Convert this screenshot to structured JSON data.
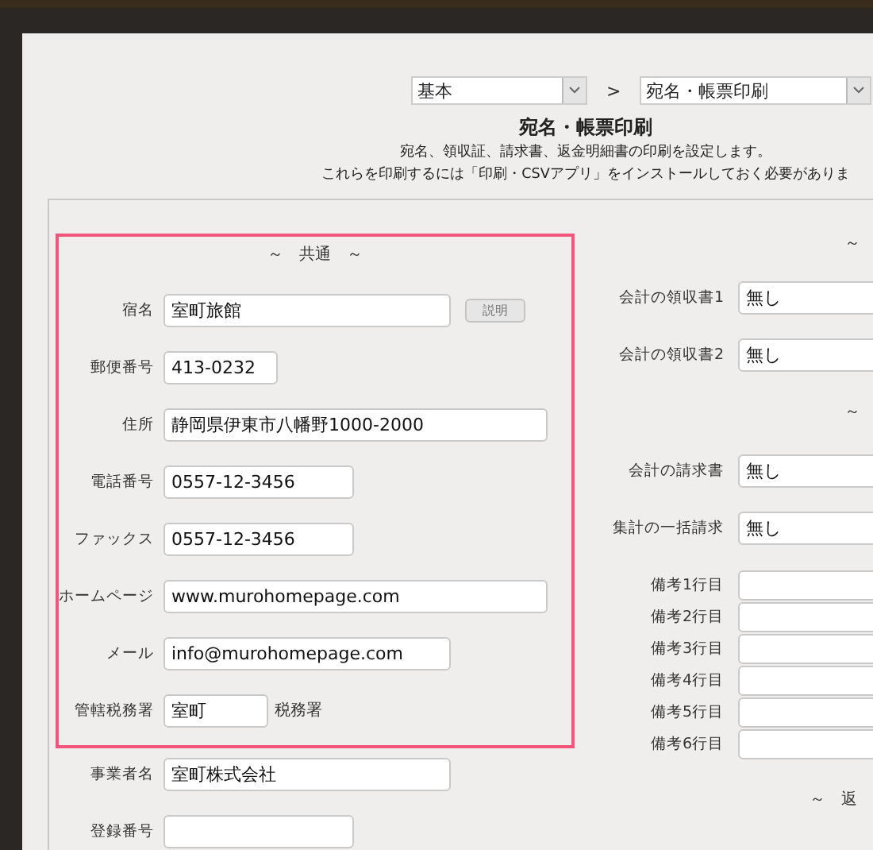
{
  "breadcrumb": {
    "levels": [
      {
        "value": "基本"
      },
      {
        "value": "宛名・帳票印刷"
      }
    ],
    "separator": ">"
  },
  "title": "宛名・帳票印刷",
  "description": [
    "宛名、領収証、請求書、返金明細書の印刷を設定します。",
    "これらを印刷するには「印刷・CSVアプリ」をインストールしておく必要がありま"
  ],
  "common": {
    "heading": "～　共通　～",
    "highlighted": true,
    "fields": [
      {
        "label": "宿名",
        "value": "室町旅館",
        "button": "説明"
      },
      {
        "label": "郵便番号",
        "value": "413-0232"
      },
      {
        "label": "住所",
        "value": "静岡県伊東市八幡野1000-2000"
      },
      {
        "label": "電話番号",
        "value": "0557-12-3456"
      },
      {
        "label": "ファックス",
        "value": "0557-12-3456"
      },
      {
        "label": "ホームページ",
        "value": "www.murohomepage.com"
      },
      {
        "label": "メール",
        "value": "info@murohomepage.com"
      },
      {
        "label": "管轄税務署",
        "value": "室町",
        "suffix": "税務署"
      }
    ]
  },
  "business_fields": [
    {
      "label": "事業者名",
      "value": "室町株式会社"
    },
    {
      "label": "登録番号"
    }
  ],
  "receipts": {
    "heading": "～",
    "fields": [
      {
        "label": "会計の領収書1",
        "value": "無し"
      },
      {
        "label": "会計の領収書2",
        "value": "無し"
      }
    ]
  },
  "invoices": {
    "heading": "～",
    "fields": [
      {
        "label": "会計の請求書",
        "value": "無し"
      },
      {
        "label": "集計の一括請求",
        "value": "無し"
      }
    ]
  },
  "notes": [
    {
      "label": "備考1行目"
    },
    {
      "label": "備考2行目"
    },
    {
      "label": "備考3行目"
    },
    {
      "label": "備考4行目"
    },
    {
      "label": "備考5行目"
    },
    {
      "label": "備考6行目"
    }
  ],
  "refund": {
    "heading": "～　返"
  }
}
